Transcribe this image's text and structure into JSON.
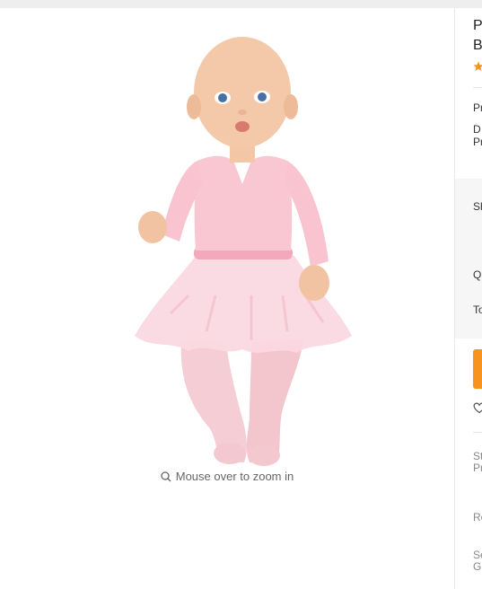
{
  "gallery": {
    "image_alt": "pink ballet outfit on baby doll",
    "zoom_hint": "Mouse over to zoom in",
    "zoom_icon": "search-icon"
  },
  "product_panel": {
    "title_line1": "P",
    "title_line2": "B",
    "rating_icon": "star-icon",
    "price_label": "Pr",
    "discount_line1": "D",
    "discount_line2": "Pr",
    "shipping_label": "Sh",
    "quantity_label": "Q",
    "total_label": "To",
    "wishlist_icon": "heart-icon",
    "store_line1": "St",
    "store_line2": "Pr",
    "returns_label": "Re",
    "service_line1": "Se",
    "service_line2": "G"
  },
  "colors": {
    "accent": "#f7931e",
    "star": "#f7931e",
    "background": "#ffffff",
    "panel_shade": "#f6f6f6"
  }
}
